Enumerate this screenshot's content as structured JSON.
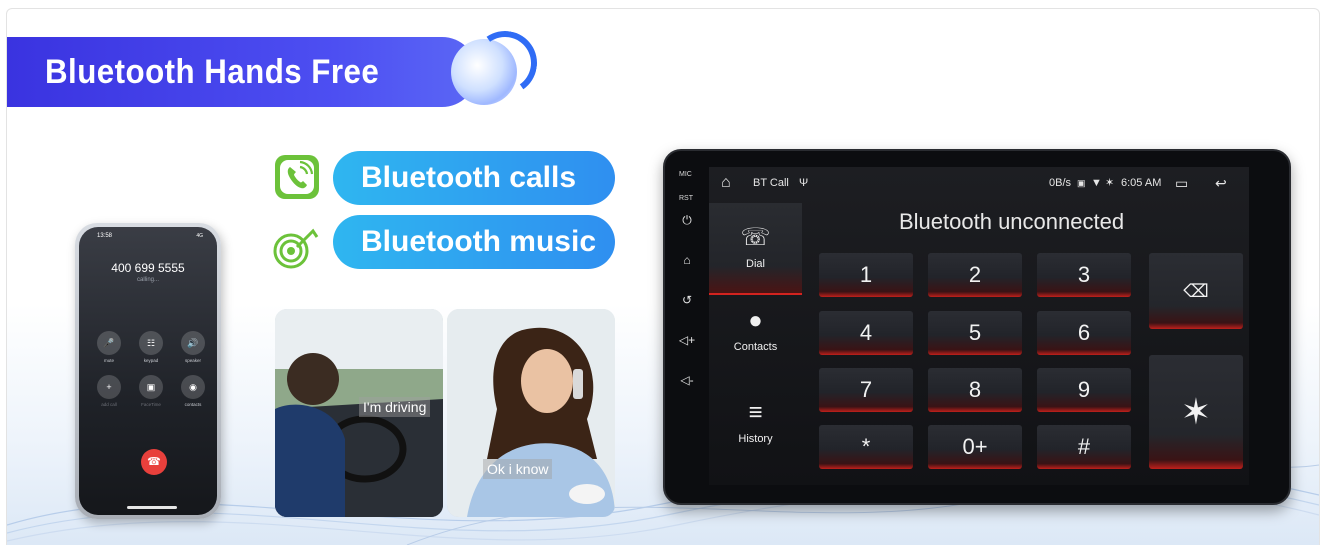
{
  "header": {
    "title": "Bluetooth Hands Free"
  },
  "features": [
    {
      "label": "Bluetooth calls",
      "icon": "phone-call-icon"
    },
    {
      "label": "Bluetooth music",
      "icon": "music-note-icon"
    }
  ],
  "phone": {
    "time": "13:58",
    "status": "4G",
    "number": "400 699 5555",
    "call_state": "calling...",
    "buttons": [
      {
        "label": "mute",
        "icon": "mic-off-icon"
      },
      {
        "label": "keypad",
        "icon": "keypad-icon"
      },
      {
        "label": "speaker",
        "icon": "speaker-icon"
      },
      {
        "label": "add call",
        "icon": "plus-icon"
      },
      {
        "label": "FaceTime",
        "icon": "video-icon"
      },
      {
        "label": "contacts",
        "icon": "contacts-icon"
      }
    ]
  },
  "photos": [
    {
      "caption": "I'm driving"
    },
    {
      "caption": "Ok i know"
    }
  ],
  "head_unit": {
    "side_labels": {
      "mic": "MIC",
      "rst": "RST"
    },
    "statusbar": {
      "app_title": "BT Call",
      "net_speed": "0B/s",
      "time": "6:05 AM"
    },
    "nav": [
      {
        "label": "Dial",
        "icon": "phone-icon"
      },
      {
        "label": "Contacts",
        "icon": "person-icon"
      },
      {
        "label": "History",
        "icon": "call-history-icon"
      }
    ],
    "connection_status": "Bluetooth unconnected",
    "keypad": [
      "1",
      "2",
      "3",
      "4",
      "5",
      "6",
      "7",
      "8",
      "9",
      "*",
      "0+",
      "#"
    ]
  },
  "colors": {
    "banner": "#3f3ee8",
    "pill": "#2fa4f0",
    "accent_red": "#d3231f",
    "icon_green": "#6cc23a"
  }
}
